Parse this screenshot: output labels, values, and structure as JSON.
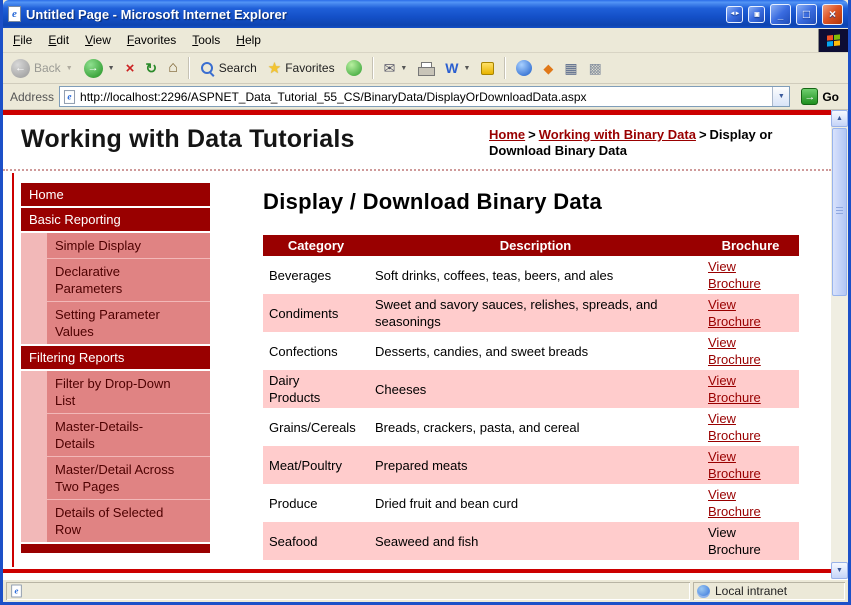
{
  "window": {
    "title": "Untitled Page - Microsoft Internet Explorer"
  },
  "menubar": {
    "items": [
      "File",
      "Edit",
      "View",
      "Favorites",
      "Tools",
      "Help"
    ]
  },
  "toolbar": {
    "back_label": "Back",
    "search_label": "Search",
    "favorites_label": "Favorites"
  },
  "addressbar": {
    "label": "Address",
    "url": "http://localhost:2296/ASPNET_Data_Tutorial_55_CS/BinaryData/DisplayOrDownloadData.aspx",
    "go_label": "Go"
  },
  "page": {
    "site_title": "Working with Data Tutorials",
    "breadcrumb": {
      "home": "Home",
      "sep1": ">",
      "section": "Working with Binary Data",
      "sep2": ">",
      "current": "Display or Download Binary Data"
    },
    "sidebar": [
      {
        "label": "Home",
        "type": "section"
      },
      {
        "label": "Basic Reporting",
        "type": "section"
      },
      {
        "label": "Simple Display",
        "type": "sub"
      },
      {
        "label": "Declarative\nParameters",
        "type": "sub"
      },
      {
        "label": "Setting Parameter\nValues",
        "type": "sub"
      },
      {
        "label": "Filtering Reports",
        "type": "section"
      },
      {
        "label": "Filter by Drop-Down\nList",
        "type": "sub"
      },
      {
        "label": "Master-Details-\nDetails",
        "type": "sub"
      },
      {
        "label": "Master/Detail Across\nTwo Pages",
        "type": "sub"
      },
      {
        "label": "Details of Selected\nRow",
        "type": "sub"
      }
    ],
    "heading": "Display / Download Binary Data",
    "table": {
      "headers": [
        "Category",
        "Description",
        "Brochure"
      ],
      "rows": [
        {
          "category": "Beverages",
          "description": "Soft drinks, coffees, teas, beers, and ales",
          "brochure": "View Brochure",
          "is_link": true
        },
        {
          "category": "Condiments",
          "description": "Sweet and savory sauces, relishes, spreads, and seasonings",
          "brochure": "View Brochure",
          "is_link": true
        },
        {
          "category": "Confections",
          "description": "Desserts, candies, and sweet breads",
          "brochure": "View Brochure",
          "is_link": true
        },
        {
          "category": "Dairy\nProducts",
          "description": "Cheeses",
          "brochure": "View Brochure",
          "is_link": true
        },
        {
          "category": "Grains/Cereals",
          "description": "Breads, crackers, pasta, and cereal",
          "brochure": "View Brochure",
          "is_link": true
        },
        {
          "category": "Meat/Poultry",
          "description": "Prepared meats",
          "brochure": "View Brochure",
          "is_link": true
        },
        {
          "category": "Produce",
          "description": "Dried fruit and bean curd",
          "brochure": "View Brochure",
          "is_link": true
        },
        {
          "category": "Seafood",
          "description": "Seaweed and fish",
          "brochure": "View Brochure",
          "is_link": false
        }
      ]
    }
  },
  "statusbar": {
    "zone": "Local intranet"
  },
  "colors": {
    "accent_red": "#cc0000",
    "header_maroon": "#990000",
    "row_pink": "#ffcccc",
    "subitem_salmon": "#e08383",
    "strip_pink": "#f2b8b8",
    "link_red": "#990000",
    "titlebar_blue": "#1450c8"
  },
  "glyphs": {
    "ie": "e",
    "back": "←",
    "forward": "→",
    "dropdown": "▼",
    "stop": "×",
    "refresh": "↻",
    "home": "⌂",
    "star": "★",
    "mail": "✉",
    "word": "W",
    "diamond": "◆",
    "calc": "▦",
    "grid": "▩",
    "minimize": "_",
    "maximize": "□",
    "close": "×",
    "extra_arrows": "◄►",
    "extra_box": "▣",
    "up": "▲",
    "down": "▼"
  }
}
